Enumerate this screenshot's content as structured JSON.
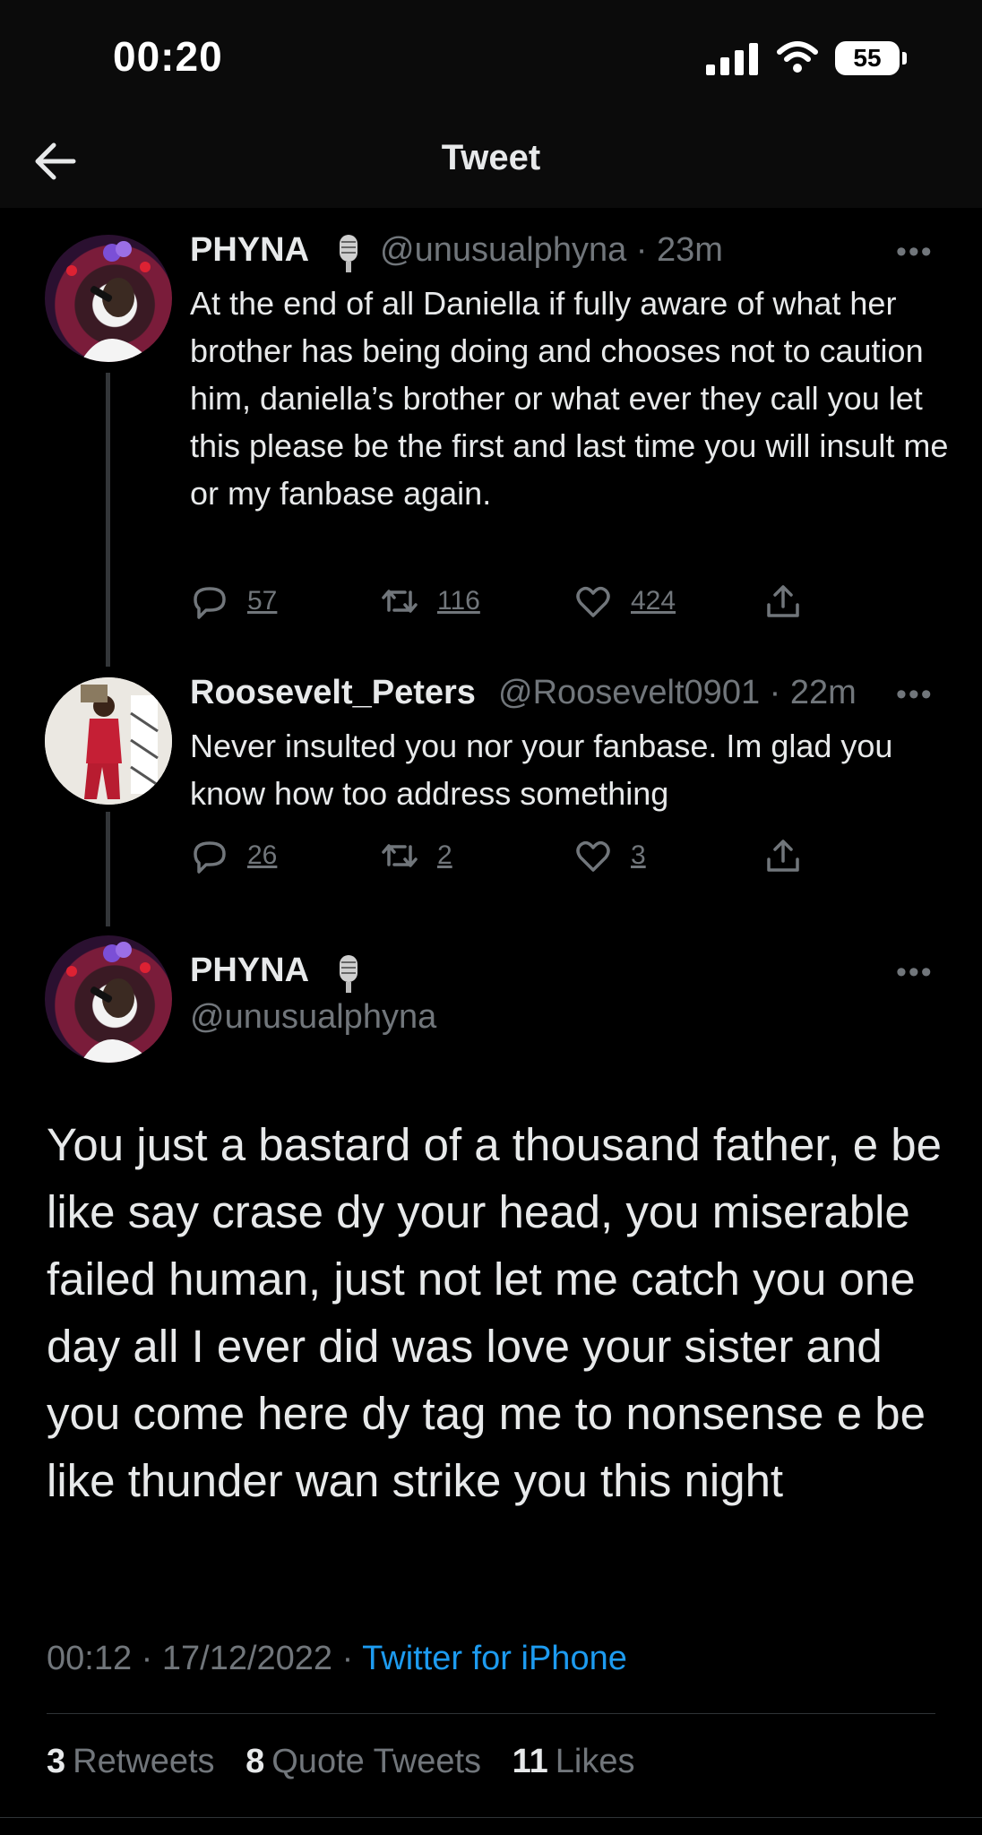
{
  "status": {
    "time": "00:20",
    "battery": "55"
  },
  "nav": {
    "title": "Tweet"
  },
  "tweets": [
    {
      "name": "PHYNA",
      "handle": "@unusualphyna",
      "time": "23m",
      "text": "At the end of all Daniella if fully aware of what her brother has being doing and chooses not to caution him, daniella’s brother or what ever they call you let this please be the first and last time you will insult me or my fanbase again.",
      "replies": "57",
      "retweets": "116",
      "likes": "424"
    },
    {
      "name": "Roosevelt_Peters",
      "handle": "@Roosevelt0901",
      "time": "22m",
      "text": "Never insulted you nor your fanbase. Im glad you know how too address something",
      "replies": "26",
      "retweets": "2",
      "likes": "3"
    }
  ],
  "main": {
    "name": "PHYNA",
    "handle": "@unusualphyna",
    "text": "You just a bastard of a thousand father, e be like say crase dy your head, you miserable failed human, just not let me catch you one day all I ever did was love your sister and you come here dy tag me to nonsense e be like thunder wan strike you this night",
    "time": "00:12",
    "date": "17/12/2022",
    "source": "Twitter for iPhone",
    "retweets_count": "3",
    "retweets_label": "Retweets",
    "quotes_count": "8",
    "quotes_label": "Quote Tweets",
    "likes_count": "11",
    "likes_label": "Likes"
  },
  "icons": [
    "back-arrow-icon",
    "signal-icon",
    "wifi-icon",
    "microphone-icon",
    "more-icon",
    "reply-icon",
    "retweet-icon",
    "like-icon",
    "share-icon"
  ],
  "colors": {
    "background": "#000000",
    "text": "#e7e9ea",
    "muted": "#71767b",
    "link": "#1d9bf0"
  }
}
